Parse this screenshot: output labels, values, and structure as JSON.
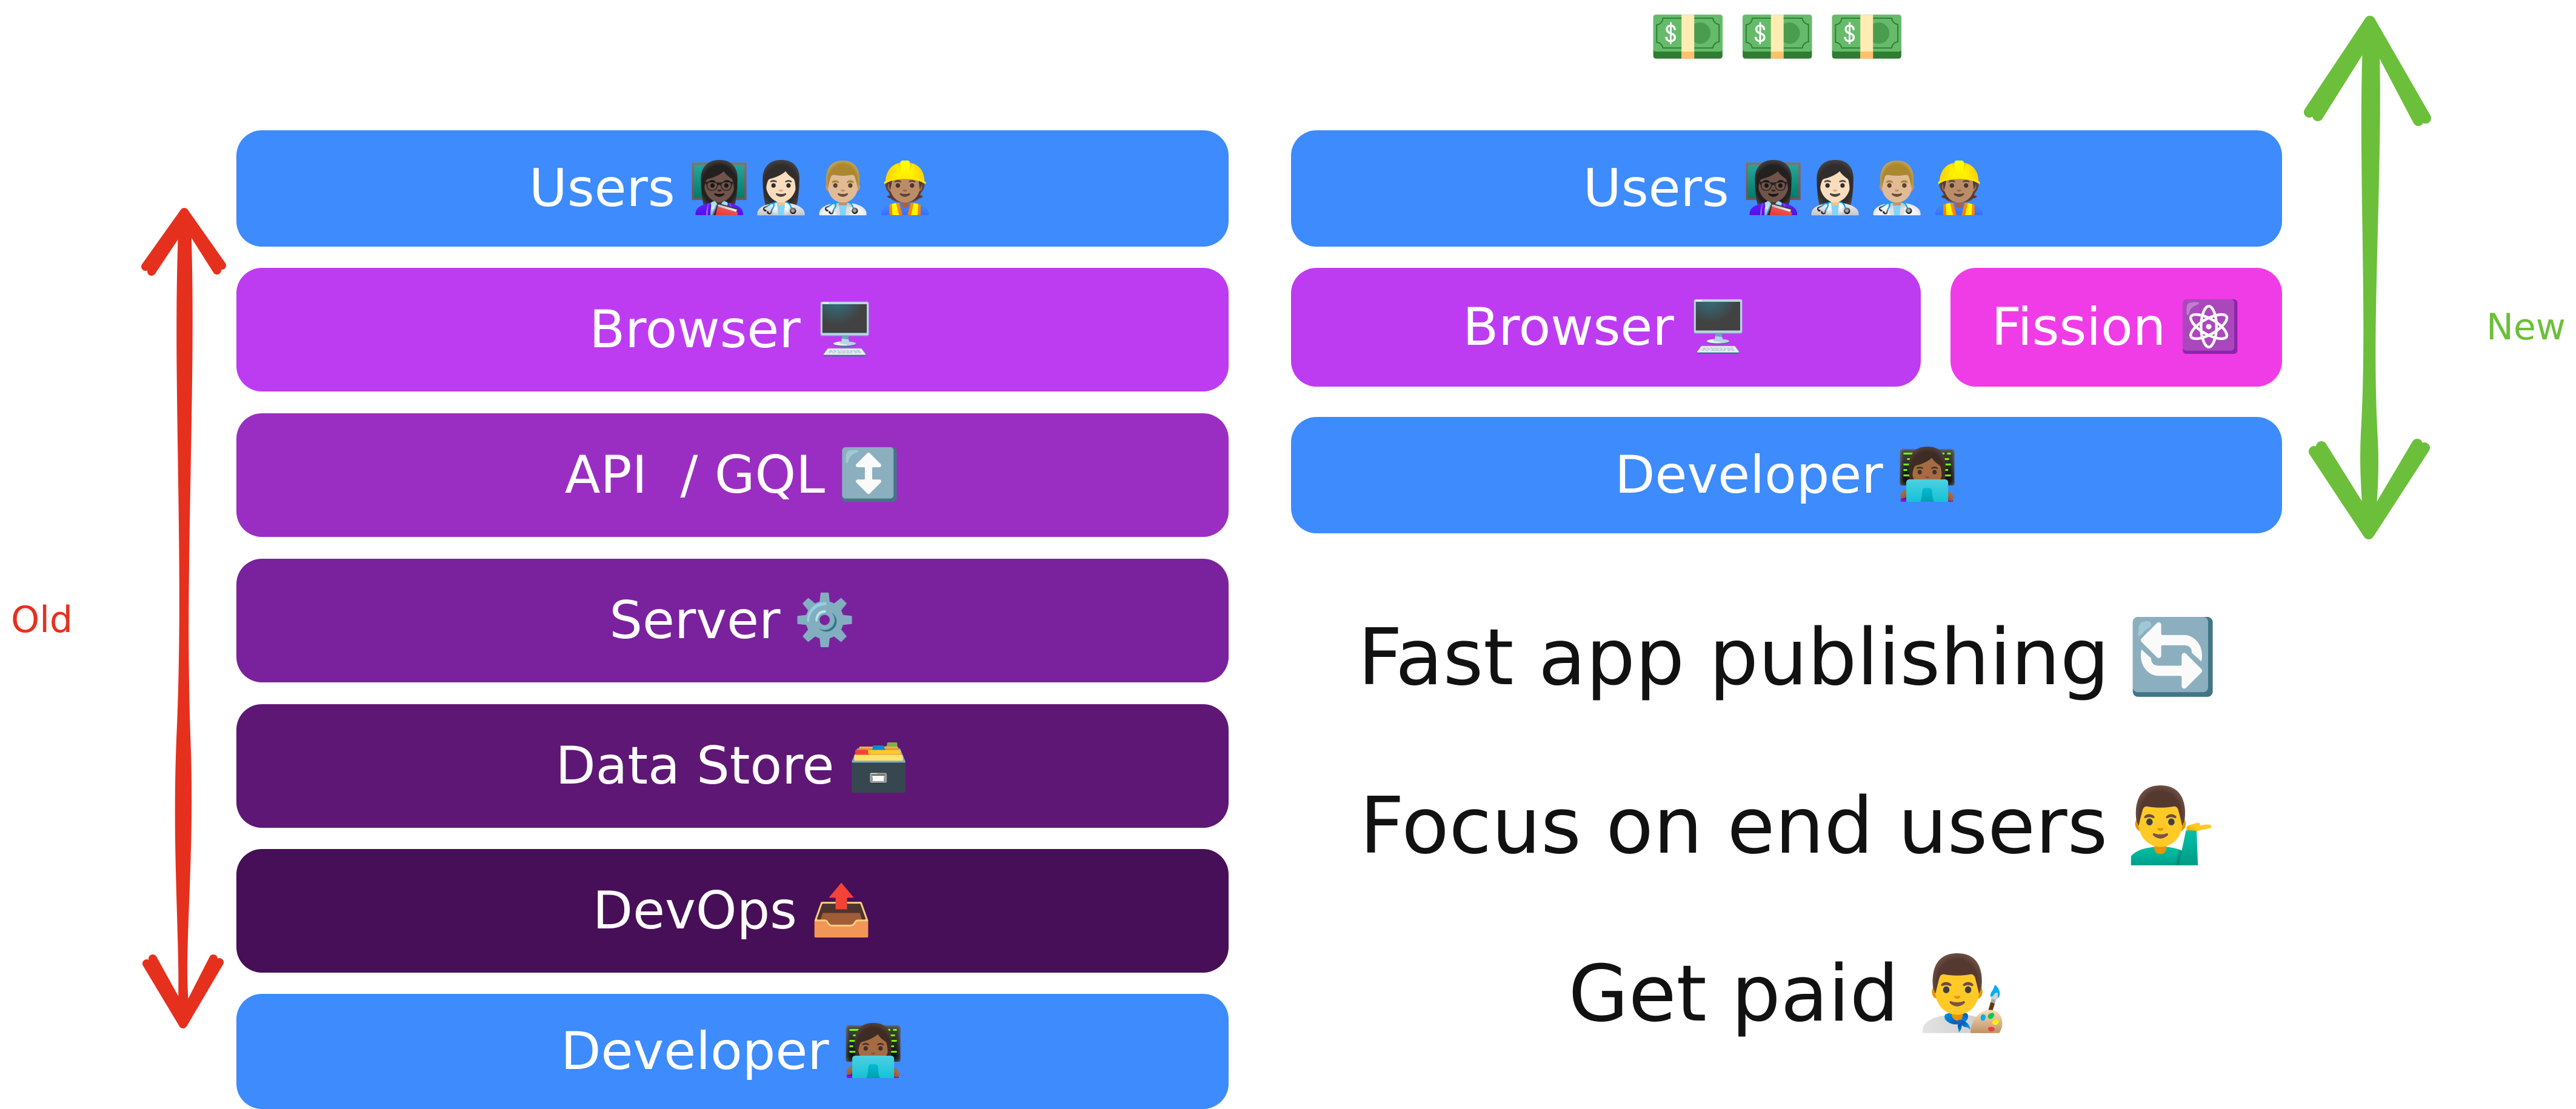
{
  "money_icons": "💵💵💵",
  "old_stack": {
    "side_label": "Old",
    "layers": [
      {
        "label": "Users",
        "emoji": "👩🏿‍🏫👩🏻‍⚕️👨🏼‍⚕️👷🏽"
      },
      {
        "label": "Browser",
        "emoji": "🖥️"
      },
      {
        "label": "API  / GQL",
        "emoji": "↕️"
      },
      {
        "label": "Server",
        "emoji": "⚙️"
      },
      {
        "label": "Data Store",
        "emoji": "🗃️"
      },
      {
        "label": "DevOps",
        "emoji": "📤"
      },
      {
        "label": "Developer",
        "emoji": "👩🏾‍💻"
      }
    ]
  },
  "new_stack": {
    "side_label": "New",
    "users": {
      "label": "Users",
      "emoji": "👩🏿‍🏫👩🏻‍⚕️👨🏼‍⚕️👷🏽"
    },
    "browser": {
      "label": "Browser",
      "emoji": "🖥️"
    },
    "fission": {
      "label": "Fission",
      "emoji": "⚛️"
    },
    "developer": {
      "label": "Developer",
      "emoji": "👩🏾‍💻"
    }
  },
  "benefits": [
    {
      "text": "Fast app publishing",
      "emoji": "🔄"
    },
    {
      "text": "Focus on end users",
      "emoji": "💁‍♂️"
    },
    {
      "text": "Get paid",
      "emoji": "👨‍🎨"
    }
  ],
  "colors": {
    "blue": "#3d8bfd",
    "magenta": "#bd3cf2",
    "fission_pink": "#f03ce6",
    "purple_api": "#9a2ec2",
    "purple_server": "#7a219e",
    "purple_store": "#5e1775",
    "purple_devops": "#470f57",
    "old_arrow": "#e6301e",
    "new_arrow": "#6cbf3a"
  }
}
